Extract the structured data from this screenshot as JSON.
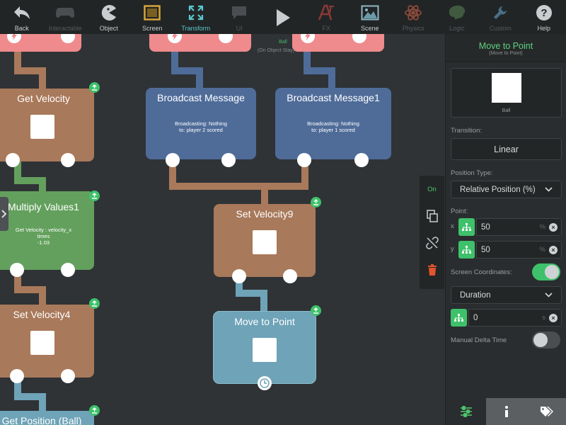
{
  "toolbar": {
    "items": [
      {
        "label": "Back",
        "icon": "back-arrow-icon",
        "state": "normal"
      },
      {
        "label": "Interactable",
        "icon": "gamepad-icon",
        "state": "dim"
      },
      {
        "label": "Object",
        "icon": "pacman-icon",
        "state": "normal"
      },
      {
        "label": "Screen",
        "icon": "screen-icon",
        "state": "normal"
      },
      {
        "label": "Transform",
        "icon": "transform-icon",
        "state": "active"
      },
      {
        "label": "UI",
        "icon": "ui-icon",
        "state": "dim"
      },
      {
        "label": "",
        "icon": "play-icon",
        "state": "normal"
      },
      {
        "label": "FX",
        "icon": "fx-icon",
        "state": "dim"
      },
      {
        "label": "Scene",
        "icon": "scene-icon",
        "state": "normal"
      },
      {
        "label": "Physics",
        "icon": "atom-icon",
        "state": "dim"
      },
      {
        "label": "Logic",
        "icon": "brain-icon",
        "state": "dim"
      },
      {
        "label": "Custom",
        "icon": "wrench-icon",
        "state": "dim"
      },
      {
        "label": "Help",
        "icon": "help-icon",
        "state": "normal"
      }
    ]
  },
  "canvas": {
    "object_label": "Ball",
    "object_sublabel": "(On Object Stay)",
    "nodes": {
      "get_velocity": {
        "title": "Get Velocity"
      },
      "multiply_values": {
        "title": "Multiply Values1",
        "subtitle_lines": [
          "Get Velocity : velocity_x",
          "times",
          "-1.03"
        ]
      },
      "set_velocity4": {
        "title": "Set Velocity4"
      },
      "get_position": {
        "title": "Get Position (Ball)"
      },
      "broadcast_message": {
        "title": "Broadcast Message",
        "subtitle_lines": [
          "Broadcasting: Nothing",
          "to: player 2 scored"
        ]
      },
      "broadcast_message1": {
        "title": "Broadcast Message1",
        "subtitle_lines": [
          "Broadcasting: Nothing",
          "to: player 1 scored"
        ]
      },
      "set_velocity9": {
        "title": "Set Velocity9"
      },
      "move_to_point": {
        "title": "Move to Point"
      }
    }
  },
  "float_tools": {
    "on_label": "On"
  },
  "inspector": {
    "title": "Move to Point",
    "subtitle": "(Move to Point)",
    "preview_caption": "Ball",
    "transition_label": "Transition:",
    "transition_value": "Linear",
    "position_type_label": "Position Type:",
    "position_type_value": "Relative Position (%)",
    "point_label": "Point:",
    "point": {
      "x_axis": "x",
      "x": "50",
      "x_unit": "%",
      "y_axis": "y",
      "y": "50",
      "y_unit": "%"
    },
    "screen_coords_label": "Screen Coordinates:",
    "screen_coords_on": true,
    "duration_label": "Duration",
    "duration_value": "0",
    "duration_unit": "s",
    "manual_delta_label": "Manual Delta Time",
    "manual_delta_on": false
  },
  "colors": {
    "accent": "#3ec16a",
    "node_brown": "#a8795a",
    "node_blue": "#4f6c99",
    "node_green": "#63a05d",
    "node_teal": "#6ea3b8",
    "node_pink": "#ef8b8d",
    "delete": "#e2542c"
  }
}
